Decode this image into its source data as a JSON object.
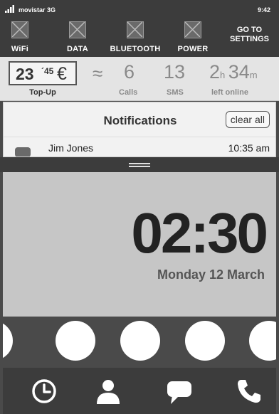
{
  "status": {
    "carrier": "movistar 3G",
    "time": "9:42",
    "signal_icon": "signal-bars-icon"
  },
  "toggles": [
    {
      "label": "WiFi",
      "icon": "wifi-placeholder-icon"
    },
    {
      "label": "DATA",
      "icon": "data-placeholder-icon"
    },
    {
      "label": "BLUETOOTH",
      "icon": "bluetooth-placeholder-icon"
    },
    {
      "label": "POWER",
      "icon": "power-placeholder-icon"
    }
  ],
  "settings": {
    "line1": "GO TO",
    "line2": "SETTINGS"
  },
  "stats": {
    "topup_int": "23",
    "topup_dec": "´45",
    "currency": "€",
    "topup_label": "Top-Up",
    "approx": "≈",
    "calls_value": "6",
    "calls_label": "Calls",
    "sms_value": "13",
    "sms_label": "SMS",
    "online_hours": "2",
    "online_hours_unit": "h",
    "online_minutes": "34",
    "online_minutes_unit": "m",
    "online_label": "left online"
  },
  "notifications": {
    "title": "Notifications",
    "clear_label": "clear all",
    "items": [
      {
        "name": "Jim Jones",
        "time": "10:35 am",
        "icon": "message-icon"
      }
    ]
  },
  "lockscreen": {
    "time": "02:30",
    "date": "Monday 12 March"
  },
  "shortcuts": {
    "count": 5
  },
  "dock": {
    "icons": [
      "clock-icon",
      "contact-icon",
      "chat-icon",
      "phone-icon"
    ]
  },
  "colors": {
    "dark": "#3c3c3c",
    "panel": "#e4e4e4",
    "clock_bg": "#c6c6c6",
    "time_text": "#222222"
  }
}
